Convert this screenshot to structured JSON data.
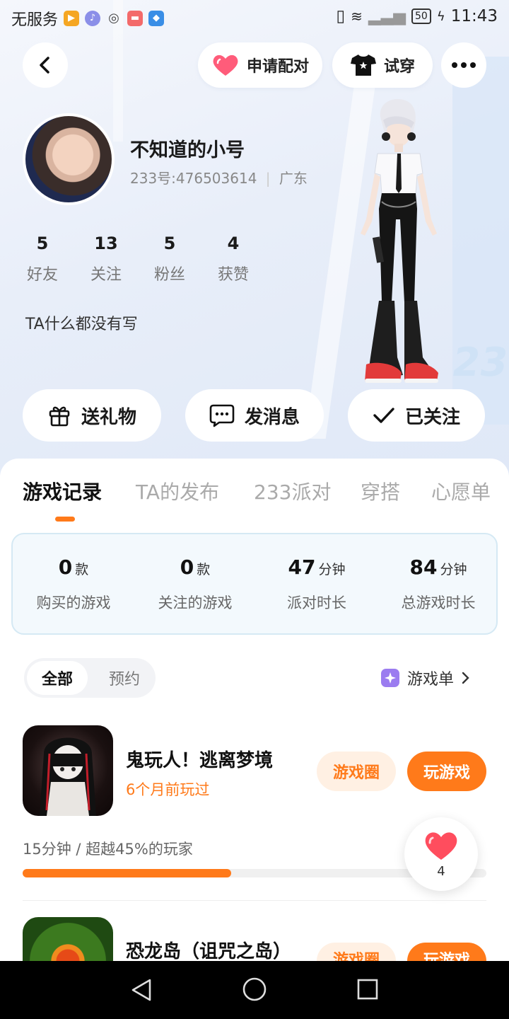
{
  "status_bar": {
    "carrier": "无服务",
    "battery": "50",
    "time": "11:43"
  },
  "top_actions": {
    "pair_label": "申请配对",
    "tryon_label": "试穿"
  },
  "profile": {
    "name": "不知道的小号",
    "id": "233号:476503614",
    "region": "广东",
    "bio": "TA什么都没有写",
    "stats": [
      {
        "value": "5",
        "label": "好友"
      },
      {
        "value": "13",
        "label": "关注"
      },
      {
        "value": "5",
        "label": "粉丝"
      },
      {
        "value": "4",
        "label": "获赞"
      }
    ]
  },
  "actions": {
    "gift": "送礼物",
    "message": "发消息",
    "followed": "已关注"
  },
  "tabs": [
    {
      "label": "游戏记录"
    },
    {
      "label": "TA的发布"
    },
    {
      "label": "233派对"
    },
    {
      "label": "穿搭"
    },
    {
      "label": "心愿单"
    }
  ],
  "summary": [
    {
      "value": "0",
      "unit": "款",
      "label": "购买的游戏"
    },
    {
      "value": "0",
      "unit": "款",
      "label": "关注的游戏"
    },
    {
      "value": "47",
      "unit": "分钟",
      "label": "派对时长"
    },
    {
      "value": "84",
      "unit": "分钟",
      "label": "总游戏时长"
    }
  ],
  "filter": {
    "all": "全部",
    "reserve": "预约"
  },
  "gamelist_label": "游戏单",
  "games": [
    {
      "title": "鬼玩人！逃离梦境",
      "last_played": "6个月前玩过",
      "circle_label": "游戏圈",
      "play_label": "玩游戏",
      "stats_text": "15分钟 / 超越45%的玩家",
      "progress": 0.45,
      "likes": "4"
    },
    {
      "title": "恐龙岛（诅咒之岛）",
      "circle_label": "游戏圈",
      "play_label": "玩游戏"
    }
  ],
  "colors": {
    "accent": "#ff7a1a",
    "accent_light": "#fff0e3",
    "like": "#ff4d5e"
  }
}
